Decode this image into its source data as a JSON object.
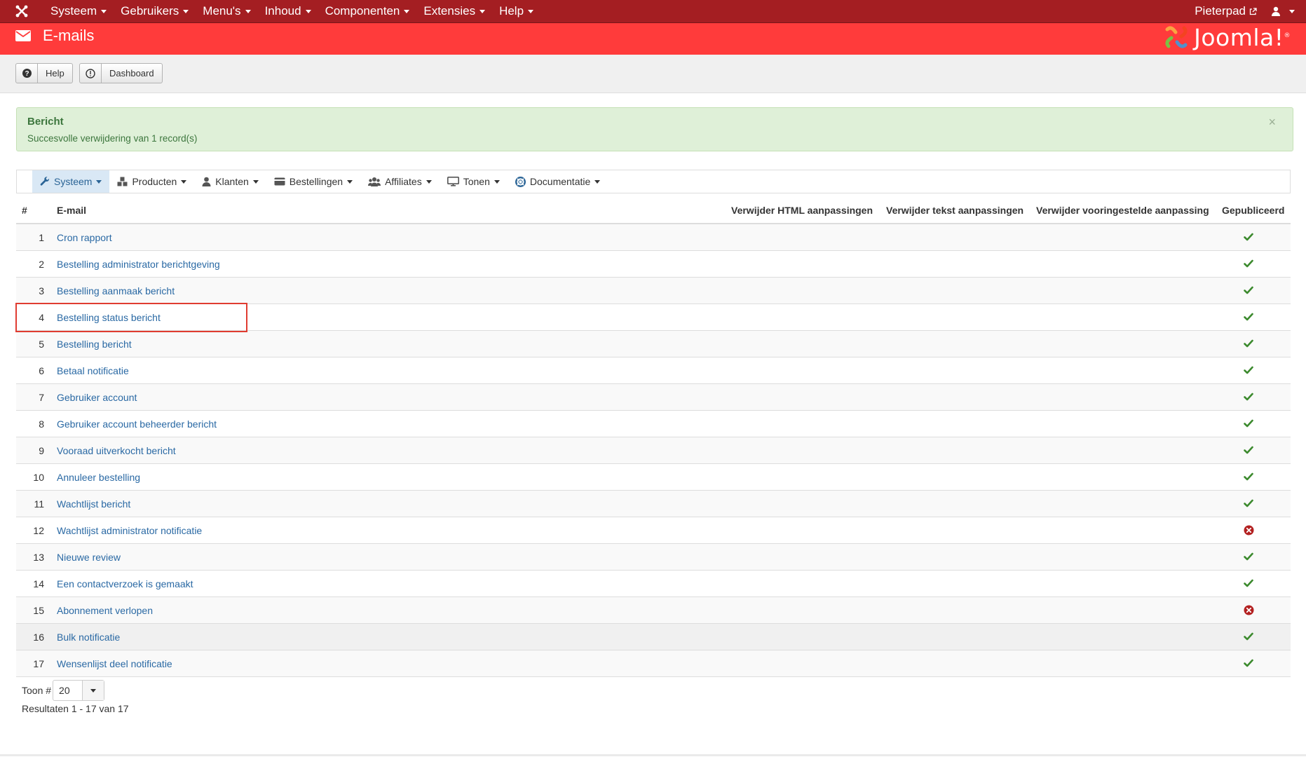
{
  "navbar": {
    "items": [
      {
        "label": "Systeem"
      },
      {
        "label": "Gebruikers"
      },
      {
        "label": "Menu's"
      },
      {
        "label": "Inhoud"
      },
      {
        "label": "Componenten"
      },
      {
        "label": "Extensies"
      },
      {
        "label": "Help"
      }
    ],
    "site_link": "Pieterpad",
    "user_icon": "user-icon"
  },
  "header": {
    "icon": "envelope-icon",
    "title": "E-mails",
    "brand": "Joomla!",
    "brand_mark": "®"
  },
  "toolbar": {
    "help_label": "Help",
    "dashboard_label": "Dashboard"
  },
  "alert": {
    "heading": "Bericht",
    "text": "Succesvolle verwijdering van 1 record(s)",
    "close": "×"
  },
  "submenu": {
    "items": [
      {
        "label": "Systeem",
        "icon": "wrench-icon"
      },
      {
        "label": "Producten",
        "icon": "cubes-icon"
      },
      {
        "label": "Klanten",
        "icon": "user-icon"
      },
      {
        "label": "Bestellingen",
        "icon": "credit-card-icon"
      },
      {
        "label": "Affiliates",
        "icon": "users-icon"
      },
      {
        "label": "Tonen",
        "icon": "monitor-icon"
      },
      {
        "label": "Documentatie",
        "icon": "lifebuoy-icon"
      }
    ]
  },
  "table": {
    "headers": {
      "num": "#",
      "email": "E-mail",
      "html": "Verwijder HTML aanpassingen",
      "text": "Verwijder tekst aanpassingen",
      "default": "Verwijder vooringestelde aanpassing",
      "published": "Gepubliceerd"
    },
    "rows": [
      {
        "num": "1",
        "email": "Cron rapport",
        "published": true
      },
      {
        "num": "2",
        "email": "Bestelling administrator berichtgeving",
        "published": true
      },
      {
        "num": "3",
        "email": "Bestelling aanmaak bericht",
        "published": true
      },
      {
        "num": "4",
        "email": "Bestelling status bericht",
        "published": true
      },
      {
        "num": "5",
        "email": "Bestelling bericht",
        "published": true
      },
      {
        "num": "6",
        "email": "Betaal notificatie",
        "published": true
      },
      {
        "num": "7",
        "email": "Gebruiker account",
        "published": true
      },
      {
        "num": "8",
        "email": "Gebruiker account beheerder bericht",
        "published": true
      },
      {
        "num": "9",
        "email": "Vooraad uitverkocht bericht",
        "published": true
      },
      {
        "num": "10",
        "email": "Annuleer bestelling",
        "published": true
      },
      {
        "num": "11",
        "email": "Wachtlijst bericht",
        "published": true
      },
      {
        "num": "12",
        "email": "Wachtlijst administrator notificatie",
        "published": false
      },
      {
        "num": "13",
        "email": "Nieuwe review",
        "published": true
      },
      {
        "num": "14",
        "email": "Een contactverzoek is gemaakt",
        "published": true
      },
      {
        "num": "15",
        "email": "Abonnement verlopen",
        "published": false
      },
      {
        "num": "16",
        "email": "Bulk notificatie",
        "published": true
      },
      {
        "num": "17",
        "email": "Wensenlijst deel notificatie",
        "published": true
      }
    ]
  },
  "pagination": {
    "limit_label": "Toon #",
    "limit_value": "20",
    "results": "Resultaten 1 - 17 van 17"
  },
  "colors": {
    "navbar": "#a41e22",
    "header": "#ff3b3b",
    "link": "#2a69a4",
    "check": "#3c8a2e",
    "unpublished": "#b32020",
    "highlight": "#e03c31"
  }
}
